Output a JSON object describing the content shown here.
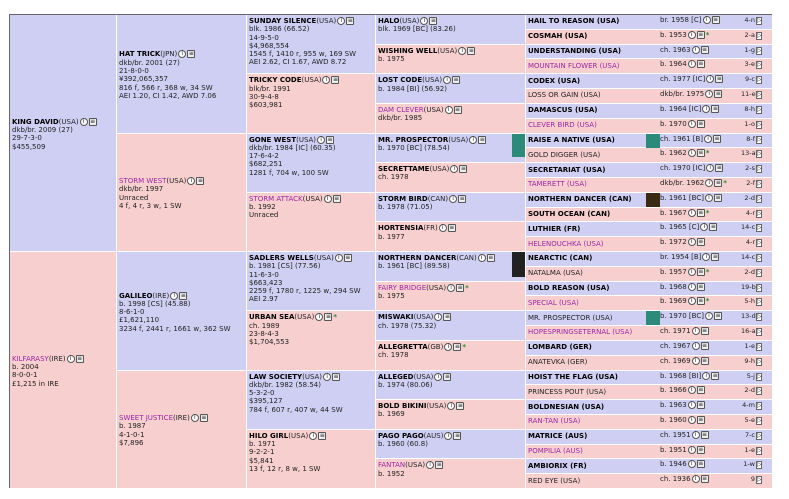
{
  "gen1": [
    {
      "name": "KING DAVID",
      "cc": "(USA)",
      "lines": [
        "dkb/br. 2009 (27)",
        "29-7-3-0",
        "$455,509"
      ],
      "male": true,
      "link": false
    },
    {
      "name": "KILFARASY",
      "cc": "(IRE)",
      "lines": [
        "b. 2004",
        "8-0-0-1",
        "£1,215 in IRE"
      ],
      "male": false,
      "link": true
    }
  ],
  "gen2": [
    {
      "name": "HAT TRICK",
      "cc": "(JPN)",
      "lines": [
        "dkb/br. 2001 (27)",
        "21-8-0-0",
        "¥392,065,357",
        "816 f, 566 r, 368 w, 34 SW",
        "AEI 1.20, CI 1.42, AWD 7.06"
      ],
      "male": true,
      "link": false
    },
    {
      "name": "STORM WEST",
      "cc": "(USA)",
      "lines": [
        "dkb/br. 1997",
        "Unraced",
        "4 f, 4 r, 3 w, 1 SW"
      ],
      "male": false,
      "link": true
    },
    {
      "name": "GALILEO",
      "cc": "(IRE)",
      "lines": [
        "b. 1998 [CS] (45.88)",
        "8-6-1-0",
        "£1,621,110",
        "3234 f, 2441 r, 1661 w, 362 SW"
      ],
      "male": true,
      "link": false
    },
    {
      "name": "SWEET JUSTICE",
      "cc": "(IRE)",
      "lines": [
        "b. 1987",
        "4-1-0-1",
        "$7,896"
      ],
      "male": false,
      "link": true
    }
  ],
  "gen3": [
    {
      "name": "SUNDAY SILENCE",
      "cc": "(USA)",
      "lines": [
        "blk. 1986 (66.52)",
        "14-9-5-0",
        "$4,968,554",
        "1545 f, 1410 r, 955 w, 169 SW",
        "AEI 2.62, CI 1.67, AWD 8.72"
      ],
      "male": true,
      "link": false
    },
    {
      "name": "TRICKY CODE",
      "cc": "(USA)",
      "lines": [
        "blk/br. 1991",
        "30-9-4-8",
        "$603,981"
      ],
      "male": false,
      "link": false
    },
    {
      "name": "GONE WEST",
      "cc": "(USA)",
      "lines": [
        "dkb/br. 1984 [IC] (60.35)",
        "17-6-4-2",
        "$682,251",
        "1281 f, 704 w, 100 SW"
      ],
      "male": true,
      "link": false
    },
    {
      "name": "STORM ATTACK",
      "cc": "(USA)",
      "lines": [
        "b. 1992",
        "Unraced"
      ],
      "male": false,
      "link": true
    },
    {
      "name": "SADLERS WELLS",
      "cc": "(USA)",
      "lines": [
        "b. 1981 [CS] (77.56)",
        "11-6-3-0",
        "$663,423",
        "2259 f, 1780 r, 1225 w, 294 SW",
        "AEI 2.97"
      ],
      "male": true,
      "link": false
    },
    {
      "name": "URBAN SEA",
      "cc": "(USA)",
      "lines": [
        "ch. 1989",
        "23-8-4-3",
        "$1,704,553"
      ],
      "male": false,
      "link": false,
      "star": true
    },
    {
      "name": "LAW SOCIETY",
      "cc": "(USA)",
      "lines": [
        "dkb/br. 1982 (58.54)",
        "5-3-2-0",
        "$395,127",
        "784 f, 607 r, 407 w, 44 SW"
      ],
      "male": true,
      "link": false
    },
    {
      "name": "HILO GIRL",
      "cc": "(USA)",
      "lines": [
        "b. 1971",
        "9-2-2-1",
        "$5,841",
        "13 f, 12 r, 8 w, 1 SW"
      ],
      "male": false,
      "link": false
    }
  ],
  "gen4": [
    {
      "name": "HALO",
      "cc": "(USA)",
      "lines": [
        "blk. 1969 [BC] (83.26)"
      ],
      "male": true,
      "link": false
    },
    {
      "name": "WISHING WELL",
      "cc": "(USA)",
      "lines": [
        "b. 1975"
      ],
      "male": false,
      "link": false
    },
    {
      "name": "LOST CODE",
      "cc": "(USA)",
      "lines": [
        "b. 1984 [BI] (56.92)"
      ],
      "male": true,
      "link": false
    },
    {
      "name": "DAM CLEVER",
      "cc": "(USA)",
      "lines": [
        "dkb/br. 1985"
      ],
      "male": false,
      "link": true
    },
    {
      "name": "MR. PROSPECTOR",
      "cc": "(USA)",
      "lines": [
        "b. 1970 [BC] (78.54)"
      ],
      "male": true,
      "link": false,
      "plain": true
    },
    {
      "name": "SECRETTAME",
      "cc": "(USA)",
      "lines": [
        "ch. 1978"
      ],
      "male": false,
      "link": false
    },
    {
      "name": "STORM BIRD",
      "cc": "(CAN)",
      "lines": [
        "b. 1978 (71.05)"
      ],
      "male": true,
      "link": false
    },
    {
      "name": "HORTENSIA",
      "cc": "(FR)",
      "lines": [
        "b. 1977"
      ],
      "male": false,
      "link": false
    },
    {
      "name": "NORTHERN DANCER",
      "cc": "(CAN)",
      "lines": [
        "b. 1961 [BC] (89.58)"
      ],
      "male": true,
      "link": false
    },
    {
      "name": "FAIRY BRIDGE",
      "cc": "(USA)",
      "lines": [
        "b. 1975"
      ],
      "male": false,
      "link": true,
      "star": true
    },
    {
      "name": "MISWAKI",
      "cc": "(USA)",
      "lines": [
        "ch. 1978 (75.32)"
      ],
      "male": true,
      "link": false
    },
    {
      "name": "ALLEGRETTA",
      "cc": "(GB)",
      "lines": [
        "ch. 1978"
      ],
      "male": false,
      "link": false,
      "star": true
    },
    {
      "name": "ALLEGED",
      "cc": "(USA)",
      "lines": [
        "b. 1974 (80.06)"
      ],
      "male": true,
      "link": false
    },
    {
      "name": "BOLD BIKINI",
      "cc": "(USA)",
      "lines": [
        "b. 1969"
      ],
      "male": false,
      "link": false
    },
    {
      "name": "PAGO PAGO",
      "cc": "(AUS)",
      "lines": [
        "b. 1960 (60.8)"
      ],
      "male": true,
      "link": false
    },
    {
      "name": "FANTAN",
      "cc": "(USA)",
      "lines": [
        "b. 1952"
      ],
      "male": false,
      "link": true
    }
  ],
  "gen5": [
    {
      "name": "HAIL TO REASON (USA)",
      "info": "br. 1958 [C]",
      "db": "4-n",
      "m": true
    },
    {
      "name": "COSMAH (USA)",
      "info": "b. 1953",
      "db": "2-a",
      "m": false,
      "star": true
    },
    {
      "name": "UNDERSTANDING (USA)",
      "info": "ch. 1963",
      "db": "1-g",
      "m": true
    },
    {
      "name": "MOUNTAIN FLOWER (USA)",
      "info": "b. 1964",
      "db": "3-e",
      "m": false,
      "link": true
    },
    {
      "name": "CODEX (USA)",
      "info": "ch. 1977 [IC]",
      "db": "9-c",
      "m": true
    },
    {
      "name": "LOSS OR GAIN (USA)",
      "info": "dkb/br. 1975",
      "db": "11-e",
      "m": false,
      "plain": true
    },
    {
      "name": "DAMASCUS (USA)",
      "info": "b. 1964 [IC]",
      "db": "8-h",
      "m": true
    },
    {
      "name": "CLEVER BIRD (USA)",
      "info": "b. 1970",
      "db": "1-o",
      "m": false,
      "link": true
    },
    {
      "name": "RAISE A NATIVE (USA)",
      "info": "ch. 1961 [B]",
      "db": "8-f",
      "m": true
    },
    {
      "name": "GOLD DIGGER (USA)",
      "info": "b. 1962",
      "db": "13-a",
      "m": false,
      "star": true,
      "plain": true
    },
    {
      "name": "SECRETARIAT (USA)",
      "info": "ch. 1970 [IC]",
      "db": "2-s",
      "m": true
    },
    {
      "name": "TAMERETT (USA)",
      "info": "dkb/br. 1962",
      "db": "2-f",
      "m": false,
      "star": true,
      "link": true
    },
    {
      "name": "NORTHERN DANCER (CAN)",
      "info": "b. 1961 [BC]",
      "db": "2-d",
      "m": true
    },
    {
      "name": "SOUTH OCEAN (CAN)",
      "info": "b. 1967",
      "db": "4-r",
      "m": false,
      "star": true
    },
    {
      "name": "LUTHIER (FR)",
      "info": "b. 1965 [C]",
      "db": "14-c",
      "m": true
    },
    {
      "name": "HELENOUCHKA (USA)",
      "info": "b. 1972",
      "db": "4-r",
      "m": false,
      "link": true
    },
    {
      "name": "NEARCTIC (CAN)",
      "info": "br. 1954 [B]",
      "db": "14-c",
      "m": true
    },
    {
      "name": "NATALMA (USA)",
      "info": "b. 1957",
      "db": "2-d",
      "m": false,
      "star": true,
      "plain": true
    },
    {
      "name": "BOLD REASON (USA)",
      "info": "b. 1968",
      "db": "19-b",
      "m": true,
      "tall": true
    },
    {
      "name": "SPECIAL (USA)",
      "info": "b. 1969",
      "db": "5-h",
      "m": false,
      "star": true,
      "link": true
    },
    {
      "name": "MR. PROSPECTOR (USA)",
      "info": "b. 1970 [BC]",
      "db": "13-d",
      "m": true,
      "plain": true
    },
    {
      "name": "HOPESPRINGSETERNAL (USA)",
      "info": "ch. 1971",
      "db": "16-a",
      "m": false,
      "link": true
    },
    {
      "name": "LOMBARD (GER)",
      "info": "ch. 1967",
      "db": "1-e",
      "m": true
    },
    {
      "name": "ANATEVKA (GER)",
      "info": "ch. 1969",
      "db": "9-h",
      "m": false,
      "plain": true
    },
    {
      "name": "HOIST THE FLAG (USA)",
      "info": "b. 1968 [BI]",
      "db": "5-j",
      "m": true
    },
    {
      "name": "PRINCESS POUT (USA)",
      "info": "b. 1966",
      "db": "2-d",
      "m": false,
      "plain": true
    },
    {
      "name": "BOLDNESIAN (USA)",
      "info": "b. 1963",
      "db": "4-m",
      "m": true
    },
    {
      "name": "RAN-TAN (USA)",
      "info": "b. 1960",
      "db": "5-e",
      "m": false,
      "link": true
    },
    {
      "name": "MATRICE (AUS)",
      "info": "ch. 1951",
      "db": "7-c",
      "m": true
    },
    {
      "name": "POMPILIA (AUS)",
      "info": "b. 1951",
      "db": "1-e",
      "m": false,
      "link": true
    },
    {
      "name": "AMBIORIX (FR)",
      "info": "b. 1946",
      "db": "1-w",
      "m": true
    },
    {
      "name": "RED EYE (USA)",
      "info": "ch. 1936",
      "db": "9",
      "m": false,
      "plain": true
    }
  ]
}
